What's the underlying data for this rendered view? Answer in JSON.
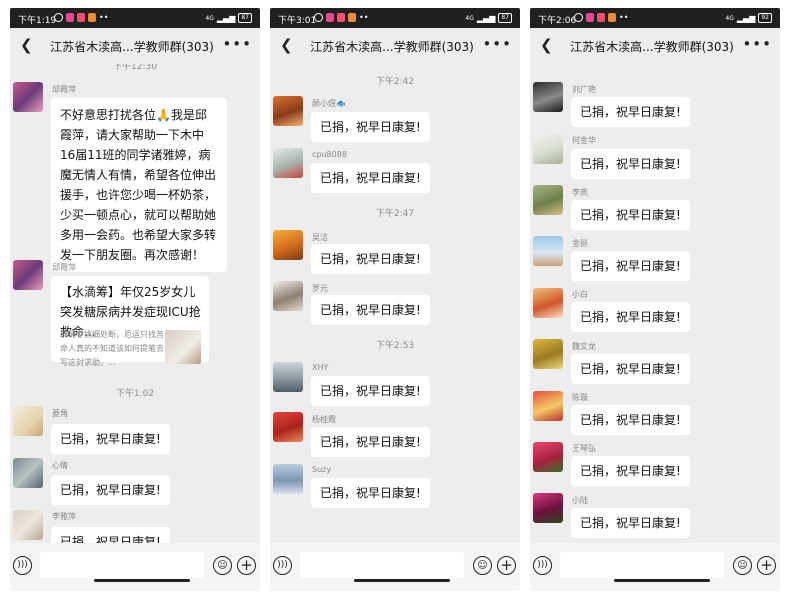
{
  "colors": {
    "status_bar": "#202020",
    "chat_bg": "#ededed",
    "bubble": "#ffffff",
    "meta_text": "#8c8c8c"
  },
  "phones": [
    {
      "status": {
        "time": "下午1:19",
        "signal": "4G",
        "battery": "87"
      },
      "title": "江苏省木渎高...学教师群(303)",
      "timestamps": [
        "下午12:30",
        "下午1:02"
      ],
      "messages": [
        {
          "sender": "邱霞萍",
          "text": "不好意思打扰各位🙏我是邱霞萍，请大家帮助一下木中16届11班的同学诸雅婷，病魔无情人有情，希望各位伸出援手，也许您少喝一杯奶茶，少买一顿点心，就可以帮助她多用一会药。也希望大家多转发一下朋友圈。再次感谢！"
        },
        {
          "sender": "邱霞萍",
          "card_title": "【水滴筹】年仅25岁女儿突发糖尿病并发症现ICU抢救命...",
          "card_desc": "麻绳专挑细处断，厄运只找苦命人真的不知道该如何提笔去写这封求助，..."
        },
        {
          "sender": "菱角",
          "text": "已捐，祝早日康复!"
        },
        {
          "sender": "心情",
          "text": "已捐，祝早日康复!"
        },
        {
          "sender": "李雅萍",
          "text": "已捐，祝早日康复!"
        }
      ]
    },
    {
      "status": {
        "time": "下午3:01",
        "signal": "4G",
        "battery": "87"
      },
      "title": "江苏省木渎高...学教师群(303)",
      "timestamps": [
        "下午2:42",
        "下午2:47",
        "下午2:53"
      ],
      "messages": [
        {
          "sender": "顾小煜🐟",
          "text": "已捐，祝早日康复!"
        },
        {
          "sender": "cpu8088",
          "text": "已捐，祝早日康复!"
        },
        {
          "sender": "吴洁",
          "text": "已捐，祝早日康复!"
        },
        {
          "sender": "罗元",
          "text": "已捐，祝早日康复!"
        },
        {
          "sender": "XHY",
          "text": "已捐，祝早日康复!"
        },
        {
          "sender": "杨桂霞",
          "text": "已捐，祝早日康复!"
        },
        {
          "sender": "Suzy",
          "text": "已捐，祝早日康复!"
        }
      ]
    },
    {
      "status": {
        "time": "下午2:06",
        "signal": "4G",
        "battery": "92"
      },
      "title": "江苏省木渎高...学教师群(303)",
      "timestamps": [],
      "messages": [
        {
          "sender": "刘广艳",
          "text": "已捐，祝早日康复!"
        },
        {
          "sender": "何金华",
          "text": "已捐，祝早日康复!"
        },
        {
          "sender": "李燕",
          "text": "已捐，祝早日康复!"
        },
        {
          "sender": "金挺",
          "text": "已捐，祝早日康复!"
        },
        {
          "sender": "小白",
          "text": "已捐，祝早日康复!"
        },
        {
          "sender": "魏文龙",
          "text": "已捐，祝早日康复!"
        },
        {
          "sender": "陈璇",
          "text": "已捐，祝早日康复!"
        },
        {
          "sender": "王琴弘",
          "text": "已捐，祝早日康复!"
        },
        {
          "sender": "小陆",
          "text": "已捐，祝早日康复!"
        }
      ]
    }
  ],
  "icons": {
    "back": "‹",
    "more": "···",
    "voice": "voice-icon",
    "emoji": "emoji-icon",
    "plus": "plus-icon"
  }
}
